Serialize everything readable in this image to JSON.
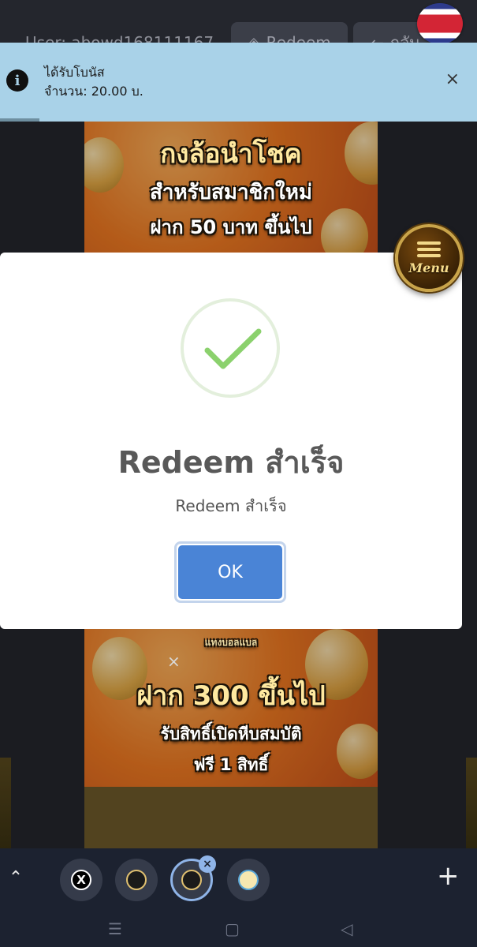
{
  "header": {
    "user_label": "User: abowd168111167",
    "redeem_label": "Redeem",
    "back_label": "กลับ"
  },
  "toast": {
    "title": "ได้รับโบนัส",
    "body": "จำนวน: 20.00 บ.",
    "close": "×"
  },
  "banner_top": {
    "line1": "กงล้อนำโชค",
    "line2": "สำหรับสมาชิกใหม่",
    "line3": "ฝาก 50 บาท ขึ้นไป"
  },
  "banner_bottom": {
    "logo": "แทงบอลแบล",
    "line1": "ฝาก 300 ขึ้นไป",
    "line2": "รับสิทธิ์เปิดหีบสมบัติ",
    "line3": "ฟรี 1 สิทธิ์"
  },
  "modal": {
    "title": "Redeem สำเร็จ",
    "text": "Redeem สำเร็จ",
    "ok_label": "OK"
  },
  "menu": {
    "label": "Menu"
  },
  "colors": {
    "toast_bg": "#a9d2e8",
    "ok_button": "#4a84d6",
    "check_green": "#8bd16d",
    "tab_active": "#8fb4e8"
  },
  "icons": {
    "toast": "info-icon",
    "check": "check-icon",
    "flag": "thailand-flag-icon",
    "x_logo": "x-logo-icon"
  },
  "tabbar": {
    "tab1": "X",
    "close": "×",
    "plus": "+"
  },
  "navbar": {
    "recent": "☰",
    "home": "▢",
    "back": "◁"
  }
}
